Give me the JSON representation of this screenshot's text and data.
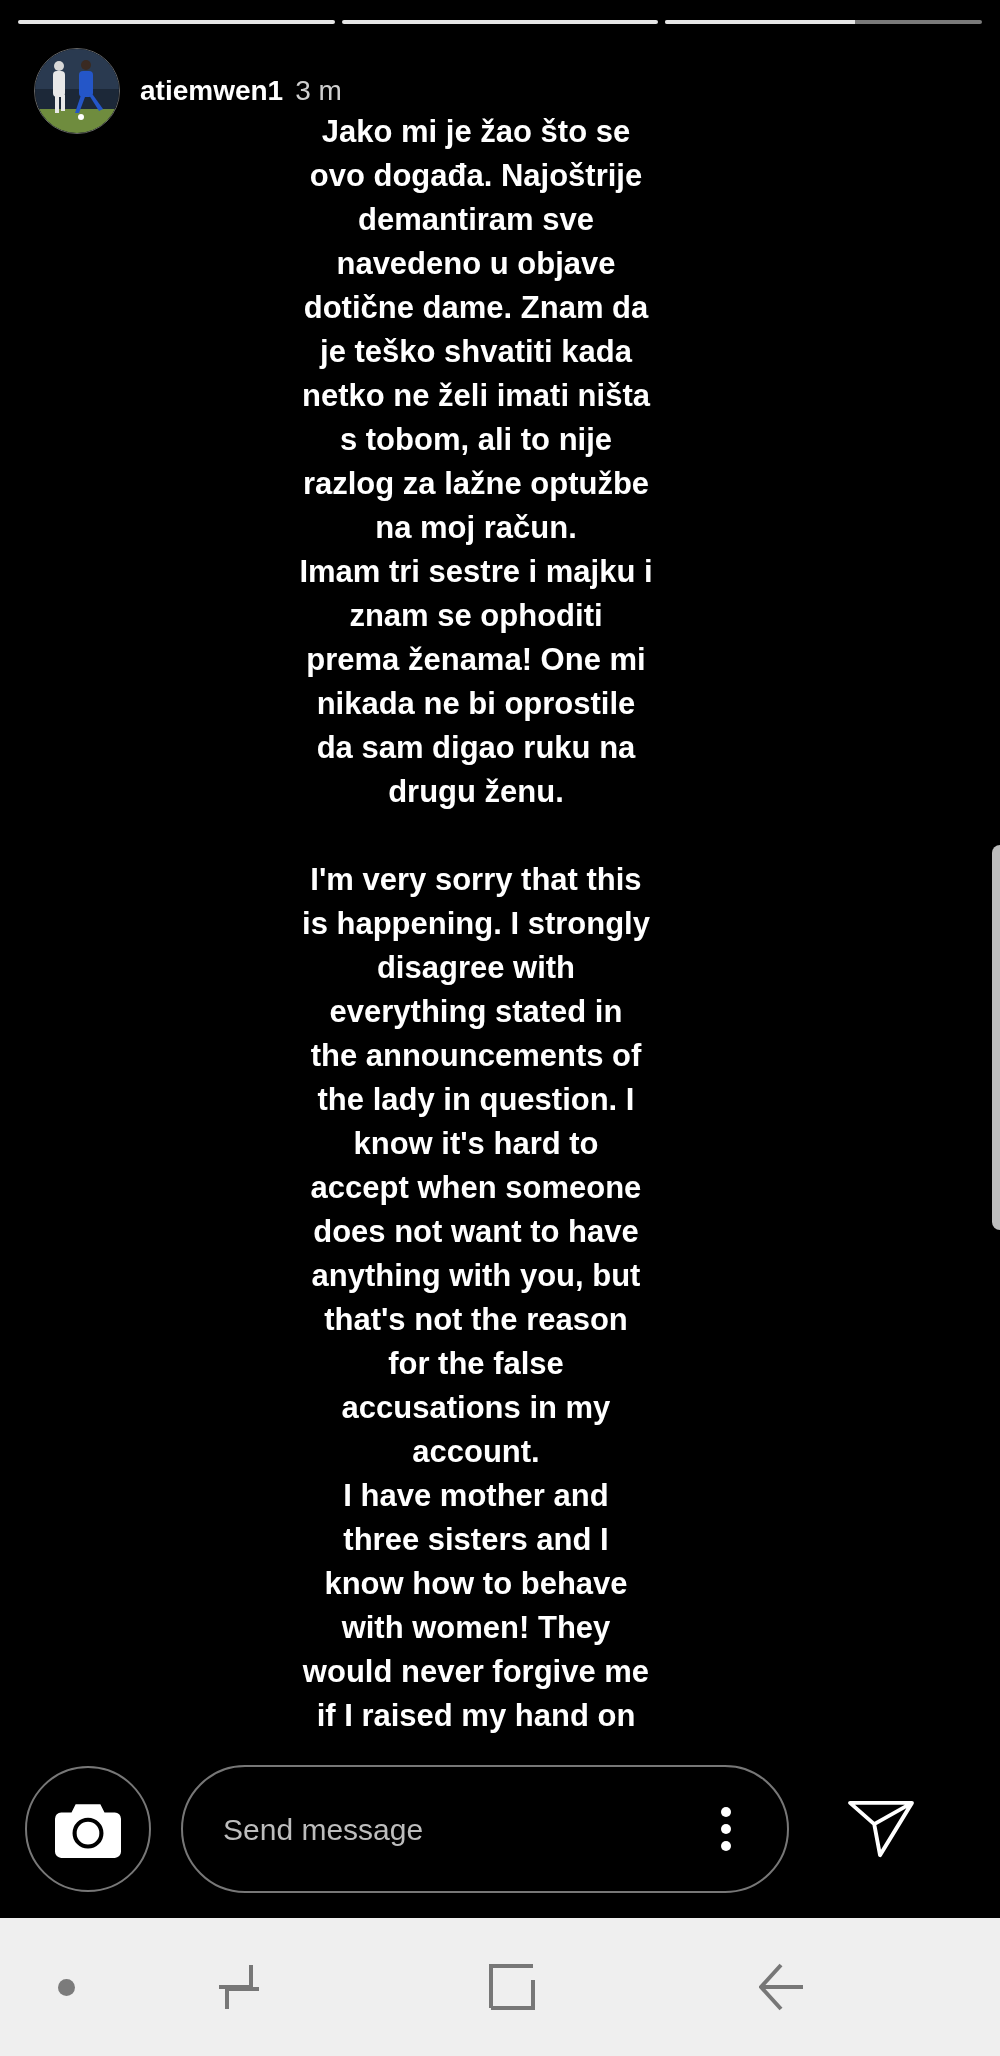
{
  "progress": [
    {
      "level": 1
    },
    {
      "level": 1
    },
    {
      "level": 0.6
    }
  ],
  "header": {
    "username": "atiemwen1",
    "time": "3 m"
  },
  "story_paragraphs": [
    [
      "Jako mi je žao što se",
      "ovo događa. Najoštrije",
      "demantiram sve",
      "navedeno u objave",
      "dotične dame. Znam da",
      "je teško shvatiti kada",
      "netko ne želi imati ništa",
      "s tobom, ali to nije",
      "razlog za lažne optužbe",
      "na moj račun."
    ],
    [
      "Imam tri sestre i majku i",
      "znam se ophoditi",
      "prema ženama! One mi",
      "nikada ne bi oprostile",
      "da sam digao ruku na",
      "drugu ženu."
    ],
    [
      "I'm very sorry that this",
      "is happening. I strongly",
      "disagree with",
      "everything stated in",
      "the announcements of",
      "the lady in question. I",
      "know it's hard to",
      "accept when someone",
      "does not want to have",
      "anything with you, but",
      "that's not the reason",
      "for the false",
      "accusations in my",
      "account."
    ],
    [
      "I have mother and",
      "three sisters and I",
      "know how to behave",
      "with women! They",
      "would never forgive me",
      "if I raised my hand on"
    ]
  ],
  "message_field": {
    "placeholder": "Send message"
  }
}
